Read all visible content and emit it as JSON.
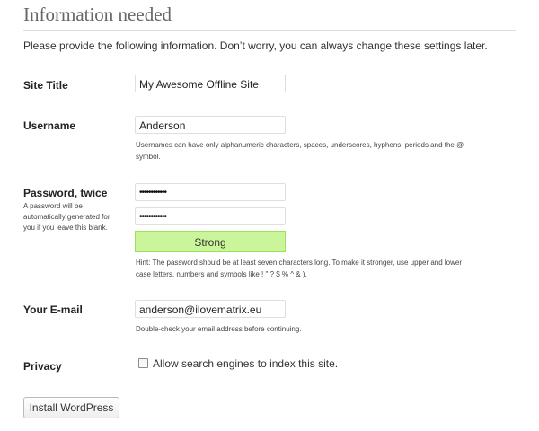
{
  "page": {
    "heading": "Information needed",
    "intro": "Please provide the following information. Don’t worry, you can always change these settings later."
  },
  "site_title": {
    "label": "Site Title",
    "value": "My Awesome Offline Site"
  },
  "username": {
    "label": "Username",
    "value": "Anderson",
    "description_line1": "Usernames can have only alphanumeric characters, spaces, underscores, hyphens, periods and the @",
    "description_line2": "symbol."
  },
  "password": {
    "label": "Password, twice",
    "note_line1": "A password will be",
    "note_line2": "automatically generated for",
    "note_line3": "you if you leave this blank.",
    "value1_masked": "••••••••••••",
    "value2_masked": "••••••••••••",
    "strength": "Strong",
    "strength_color": "#cbf59a",
    "hint_line1": "Hint: The password should be at least seven characters long. To make it stronger, use upper and lower",
    "hint_line2": "case letters, numbers and symbols like ! \" ? $ % ^ & )."
  },
  "email": {
    "label": "Your E-mail",
    "value": "anderson@ilovematrix.eu",
    "description": "Double-check your email address before continuing."
  },
  "privacy": {
    "label": "Privacy",
    "checkbox_label": "Allow search engines to index this site.",
    "checked": false
  },
  "actions": {
    "install_label": "Install WordPress"
  }
}
